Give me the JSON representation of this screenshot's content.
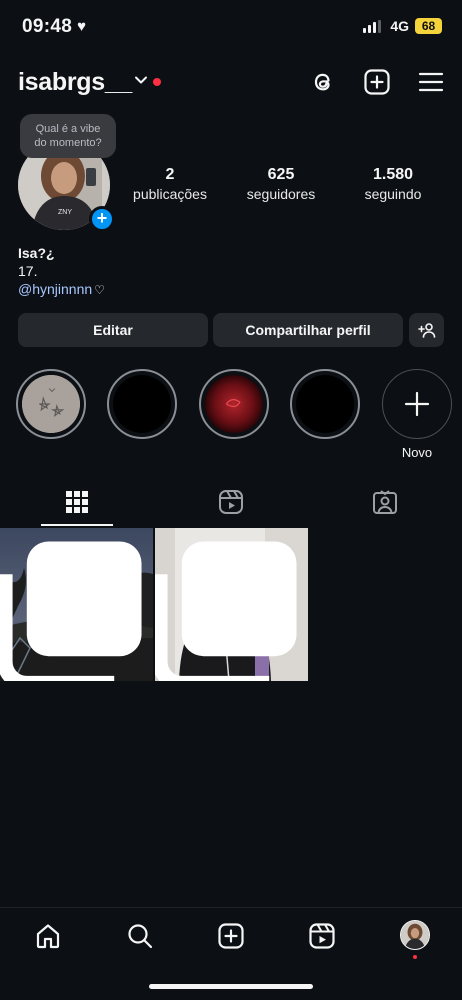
{
  "status_bar": {
    "time": "09:48",
    "heart": "♥",
    "network": "4G",
    "battery": "68"
  },
  "header": {
    "username": "isabrgs__",
    "icons": [
      "threads-icon",
      "create-icon",
      "menu-icon"
    ]
  },
  "profile": {
    "note_line1": "Qual é a vibe",
    "note_line2": "do momento?",
    "stats": [
      {
        "number": "2",
        "label": "publicações"
      },
      {
        "number": "625",
        "label": "seguidores"
      },
      {
        "number": "1.580",
        "label": "seguindo"
      }
    ],
    "bio_name": "Isa?¿",
    "bio_age": "17.",
    "bio_link": "@hynjinnnn",
    "bio_heart": "♡"
  },
  "actions": {
    "edit_label": "Editar",
    "share_label": "Compartilhar perfil"
  },
  "highlights": {
    "new_label": "Novo"
  },
  "colors": {
    "background": "#0c1014",
    "button": "#25292e",
    "accent_blue": "#0095f6",
    "notification_red": "#ff3040",
    "battery": "#f5d33a"
  }
}
